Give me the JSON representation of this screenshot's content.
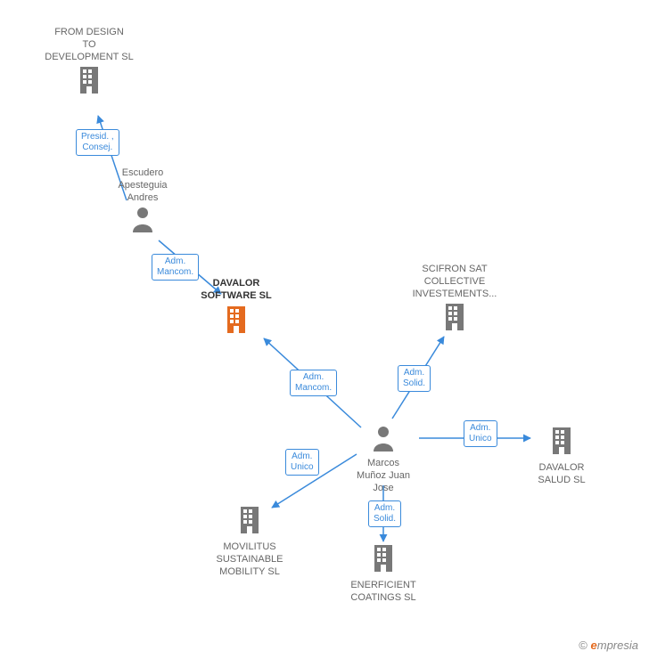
{
  "nodes": {
    "from_design": {
      "label": "FROM DESIGN TO DEVELOPMENT SL",
      "type": "company"
    },
    "escudero": {
      "label": "Escudero Apesteguia Andres",
      "type": "person"
    },
    "davalor_sw": {
      "label": "DAVALOR SOFTWARE SL",
      "type": "company",
      "highlight": true
    },
    "marcos": {
      "label": "Marcos Muñoz Juan Jose",
      "type": "person"
    },
    "scifron": {
      "label": "SCIFRON SAT COLLECTIVE INVESTEMENTS...",
      "type": "company"
    },
    "davalor_sal": {
      "label": "DAVALOR SALUD SL",
      "type": "company"
    },
    "enerficient": {
      "label": "ENERFICIENT COATINGS SL",
      "type": "company"
    },
    "movilitus": {
      "label": "MOVILITUS SUSTAINABLE MOBILITY SL",
      "type": "company"
    }
  },
  "edges": {
    "e1": {
      "label": "Presid. , Consej."
    },
    "e2": {
      "label": "Adm. Mancom."
    },
    "e3": {
      "label": "Adm. Mancom."
    },
    "e4": {
      "label": "Adm. Solid."
    },
    "e5": {
      "label": "Adm. Unico"
    },
    "e6": {
      "label": "Adm. Solid."
    },
    "e7": {
      "label": "Adm. Unico"
    }
  },
  "credit": {
    "symbol": "©",
    "brand_first": "e",
    "brand_rest": "mpresia"
  },
  "colors": {
    "link": "#3a8adb",
    "highlight_icon": "#e46a1f",
    "icon": "#787878"
  }
}
